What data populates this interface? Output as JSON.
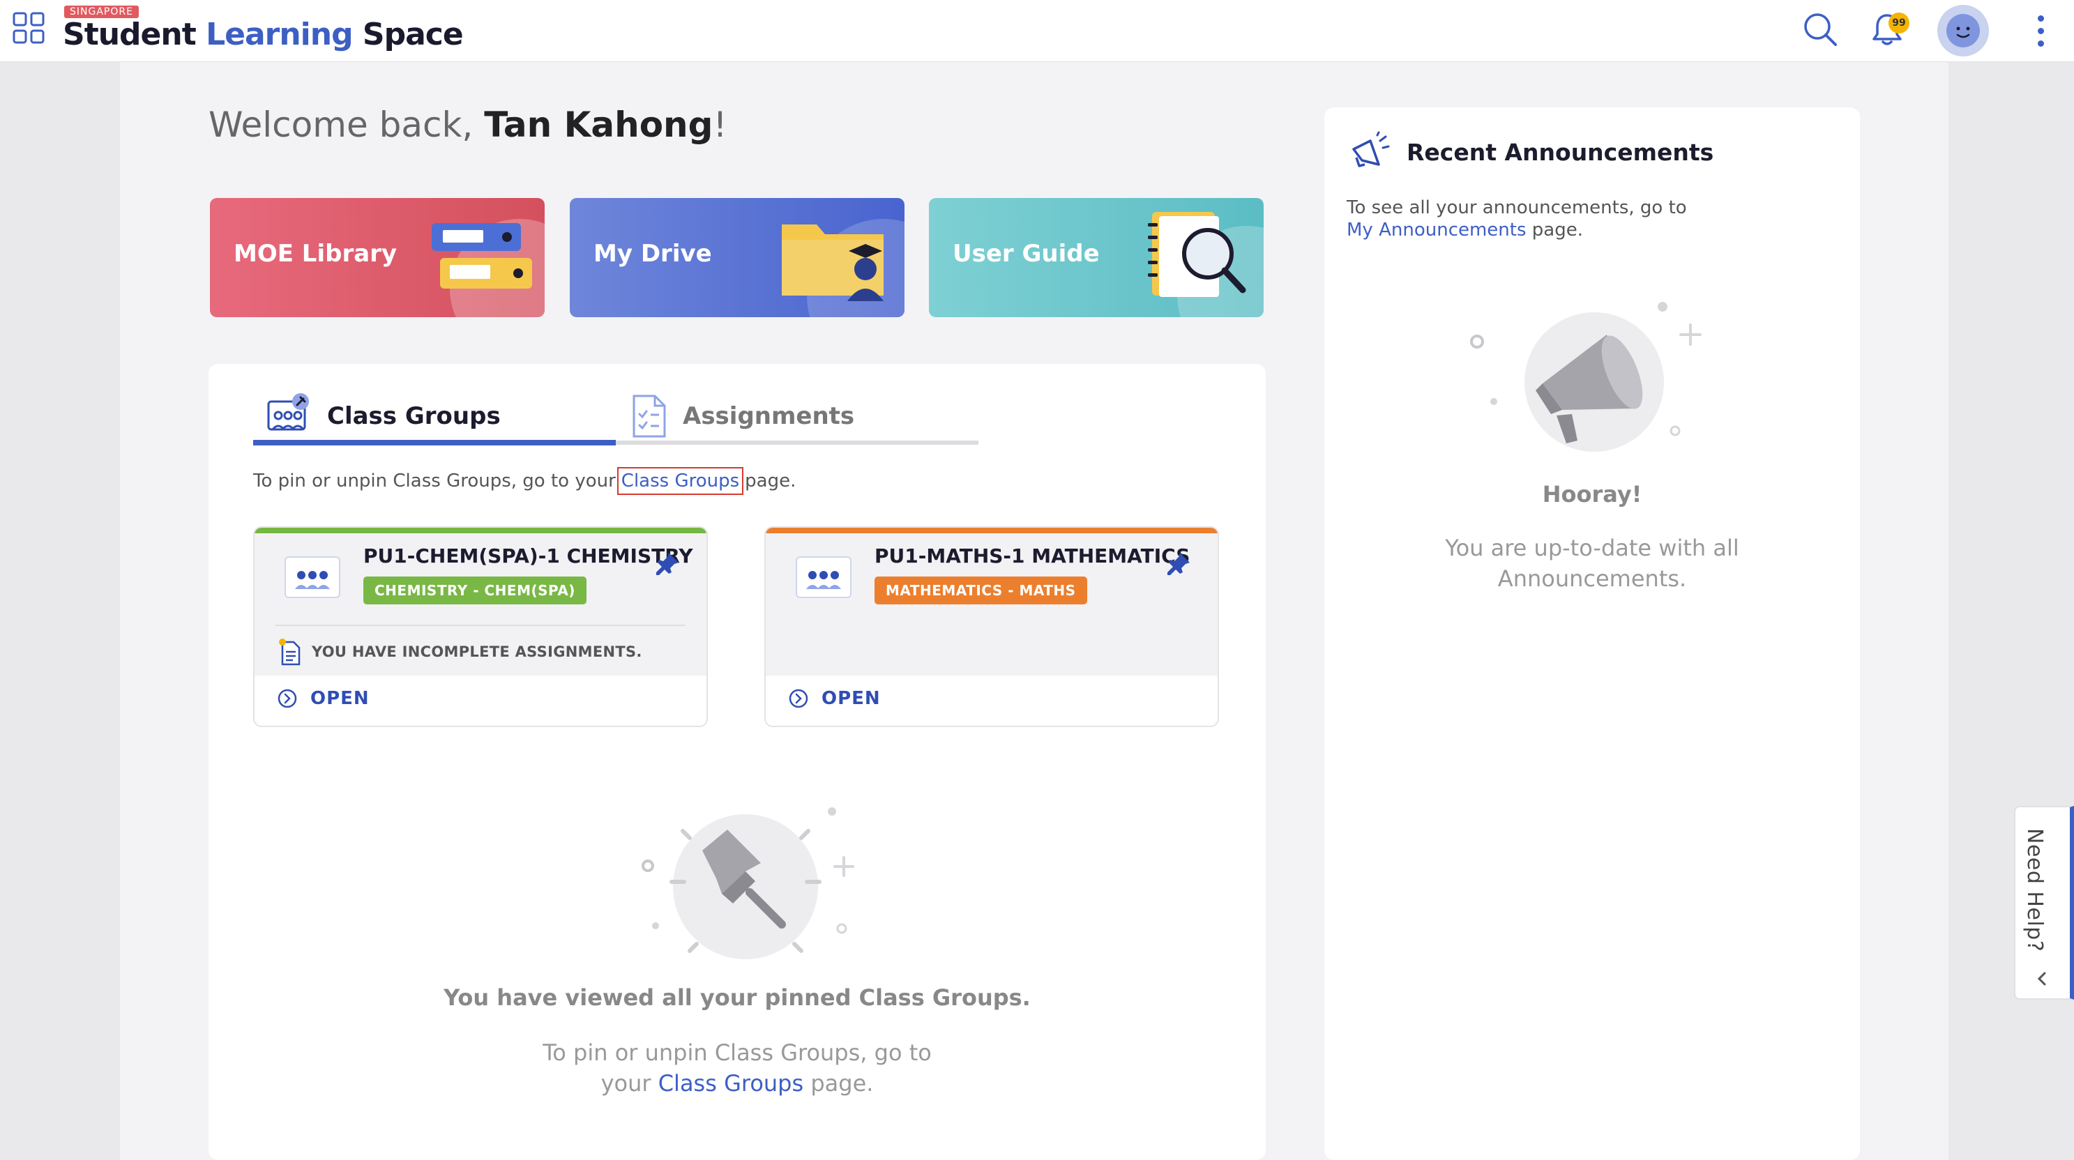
{
  "header": {
    "logo_tag": "SINGAPORE",
    "logo_word_1": "Student",
    "logo_word_2": "Learning",
    "logo_word_3": "Space",
    "notification_count": "99",
    "brand_color": "#3d5fc4"
  },
  "welcome": {
    "greeting": "Welcome back, ",
    "name": "Tan Kahong",
    "suffix": "!"
  },
  "tiles": {
    "moe_library": "MOE Library",
    "my_drive": "My Drive",
    "user_guide": "User Guide"
  },
  "tabs": {
    "class_groups": "Class Groups",
    "assignments": "Assignments",
    "active": "Class Groups"
  },
  "pin_hint": {
    "before": "To pin or unpin Class Groups, go to your",
    "link": "Class Groups",
    "after": "page."
  },
  "cards": [
    {
      "title": "PU1-CHEM(SPA)-1 CHEMISTRY",
      "subject": "CHEMISTRY - CHEM(SPA)",
      "notice": "YOU HAVE INCOMPLETE ASSIGNMENTS.",
      "open_label": "OPEN",
      "accent": "#76b742"
    },
    {
      "title": "PU1-MATHS-1 MATHEMATICS",
      "subject": "MATHEMATICS - MATHS",
      "open_label": "OPEN",
      "accent": "#ec7f2e"
    }
  ],
  "empty_state": {
    "title": "You have viewed all your pinned Class Groups.",
    "desc_1": "To pin or unpin Class Groups, go to",
    "desc_2_before": "your ",
    "desc_2_link": "Class Groups",
    "desc_2_after": " page."
  },
  "announcements": {
    "title": "Recent Announcements",
    "desc_1": "To see all your announcements, go to",
    "desc_link": "My Announcements",
    "desc_2": " page.",
    "hooray": "Hooray!",
    "sub": "You are up-to-date with all Announcements."
  },
  "help": {
    "label": "Need Help?"
  }
}
